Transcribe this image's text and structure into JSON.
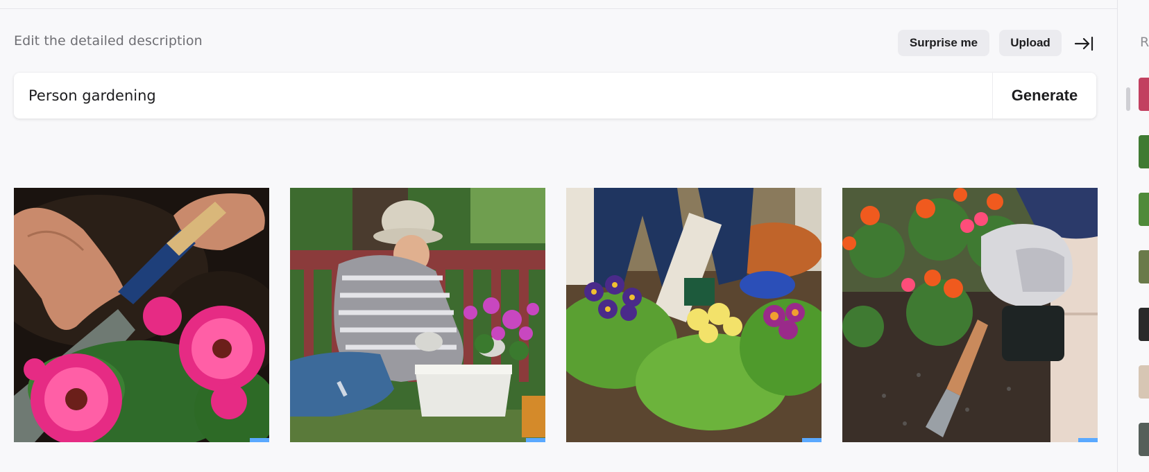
{
  "header": {
    "edit_label": "Edit the detailed description",
    "surprise_label": "Surprise me",
    "upload_label": "Upload"
  },
  "prompt": {
    "value": "Person gardening",
    "generate_label": "Generate"
  },
  "results": [
    {
      "label": "Hands planting pink gerbera daisies with trowel"
    },
    {
      "label": "Woman in bucket hat kneeling and potting flowers"
    },
    {
      "label": "Gloved gardener planting primroses"
    },
    {
      "label": "Gloved hand digging with trowel among orange flowers"
    }
  ],
  "sidebar": {
    "label": "Recent"
  },
  "colors": {
    "background": "#f8f8fa",
    "button_bg": "#ebebef",
    "text": "#1d1d1f",
    "muted": "#6e6e73"
  }
}
